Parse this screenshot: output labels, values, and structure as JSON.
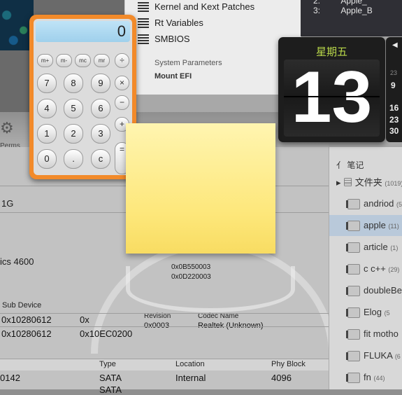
{
  "background_app": {
    "menu_items": [
      "Kernel and Kext Patches",
      "Rt Variables",
      "SMBIOS",
      "System Parameters",
      "Mount EFI"
    ],
    "top_right_rows": [
      {
        "num": "2:",
        "text": "Apple_"
      },
      {
        "num": "3:",
        "text": "Apple_B"
      }
    ],
    "perms_label": "Perms",
    "row_1g": "1G",
    "row_gfx": "ics 4600",
    "sub_device_header": "Sub Device",
    "sub_device_rows": [
      "0x10280612",
      "0x10280612"
    ],
    "sub_device_extra": [
      "0x",
      "0x10EC0200"
    ],
    "codec_header": [
      "Revision",
      "Codec Name"
    ],
    "codec_rows": [
      {
        "rev": "0x0003",
        "name": "Realtek (Unknown)"
      }
    ],
    "hex_values": [
      "0x0B550003",
      "0x0D220003"
    ],
    "storage_columns": [
      "Type",
      "Location",
      "Phy Block"
    ],
    "storage_rows": [
      {
        "id": "0142",
        "type": "SATA",
        "location": "Internal",
        "block": "4096"
      },
      {
        "id": "",
        "type": "SATA",
        "location": "",
        "block": ""
      }
    ]
  },
  "notes": {
    "header": "笔记",
    "root": {
      "label": "文件夹",
      "count": "(1019)"
    },
    "items": [
      {
        "label": "andriod",
        "count": "(5"
      },
      {
        "label": "apple",
        "count": "(11)"
      },
      {
        "label": "article",
        "count": "(1)"
      },
      {
        "label": "c c++",
        "count": "(29)"
      },
      {
        "label": "doubleBe",
        "count": ""
      },
      {
        "label": "Elog",
        "count": "(5"
      },
      {
        "label": "fit motho",
        "count": ""
      },
      {
        "label": "FLUKA",
        "count": "(6"
      },
      {
        "label": "fn",
        "count": "(44)"
      }
    ],
    "selected_index": 1
  },
  "calculator": {
    "display": "0",
    "memory_keys": [
      "m+",
      "m-",
      "mc",
      "mr"
    ],
    "digit_rows": [
      [
        "7",
        "8",
        "9"
      ],
      [
        "4",
        "5",
        "6"
      ],
      [
        "1",
        "2",
        "3"
      ],
      [
        "0",
        ".",
        "c"
      ]
    ],
    "op_keys": [
      "÷",
      "×",
      "−",
      "+",
      "="
    ]
  },
  "calendar": {
    "weekday": "星期五",
    "day": "13",
    "side_numbers": [
      "9",
      "16",
      "23",
      "30"
    ],
    "side_top": "23"
  },
  "sticky": {
    "text": ""
  },
  "colors": {
    "calculator_frame": "#f28a2a",
    "calendar_weekday": "#b9d84a",
    "sticky_yellow": "#fde77a",
    "notes_selection": "#b9c9da"
  }
}
